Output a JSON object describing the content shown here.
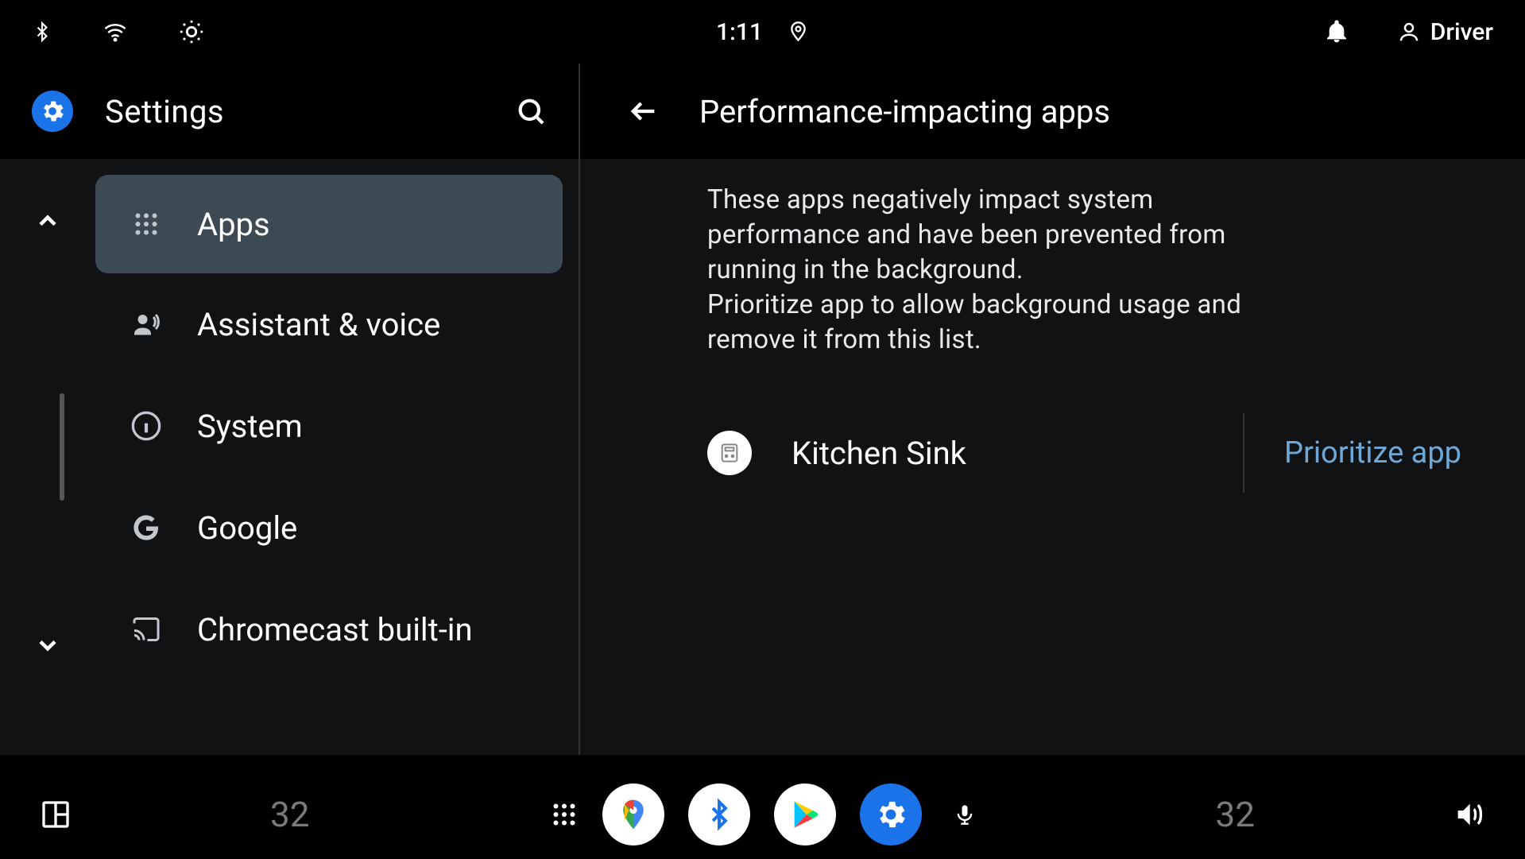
{
  "status": {
    "time": "1:11",
    "user": "Driver"
  },
  "sidebar": {
    "title": "Settings",
    "items": [
      {
        "label": "Apps",
        "icon": "apps-grid-icon",
        "active": true
      },
      {
        "label": "Assistant & voice",
        "icon": "assistant-voice-icon",
        "active": false
      },
      {
        "label": "System",
        "icon": "info-icon",
        "active": false
      },
      {
        "label": "Google",
        "icon": "google-g-icon",
        "active": false
      },
      {
        "label": "Chromecast built-in",
        "icon": "cast-icon",
        "active": false
      }
    ]
  },
  "panel": {
    "title": "Performance-impacting apps",
    "description": "These apps negatively impact system performance and have been prevented from running in the background.\nPrioritize app to allow background usage and remove it from this list.",
    "apps": [
      {
        "name": "Kitchen Sink",
        "action": "Prioritize app"
      }
    ]
  },
  "bottombar": {
    "temp_left": "32",
    "temp_right": "32"
  }
}
